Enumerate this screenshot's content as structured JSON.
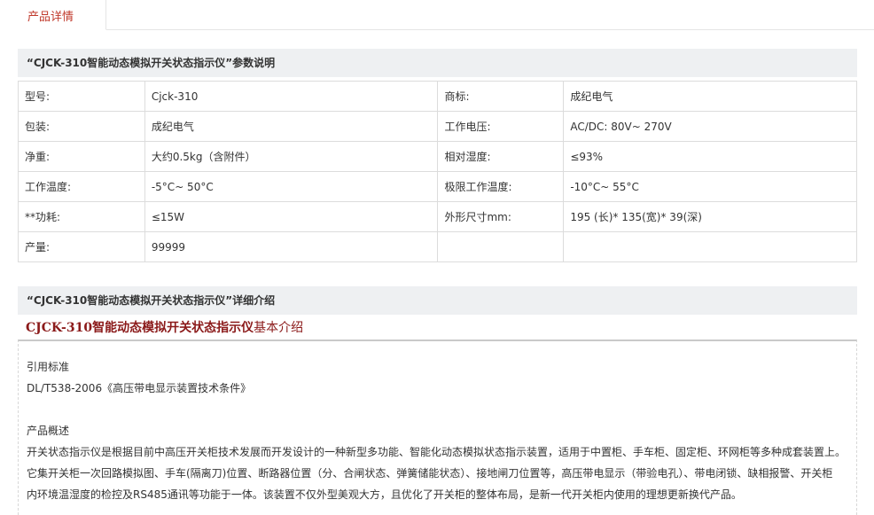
{
  "tabs": [
    {
      "label": "产品详情"
    }
  ],
  "params_section": {
    "title": "“CJCK-310智能动态模拟开关状态指示仪”参数说明"
  },
  "params": [
    [
      "型号:",
      "Cjck-310",
      "商标:",
      "成纪电气"
    ],
    [
      "包装:",
      "成纪电气",
      "工作电压:",
      "AC/DC:  80V~ 270V"
    ],
    [
      "净重:",
      "大约0.5kg（含附件）",
      "相对湿度:",
      "≤93%"
    ],
    [
      "工作温度:",
      "-5°C~ 50°C",
      "极限工作温度:",
      "-10°C~ 55°C"
    ],
    [
      "**功耗:",
      "≤15W",
      "外形尺寸mm:",
      "195 (长)* 135(宽)* 39(深)"
    ],
    [
      "产量:",
      "99999",
      "",
      ""
    ]
  ],
  "detail_section": {
    "title": "“CJCK-310智能动态模拟开关状态指示仪”详细介绍",
    "subheading_bold": "CJCK-310智能动态模拟开关状态指示仪",
    "subheading_rest": "基本介绍"
  },
  "intro": {
    "standard_label": "引用标准",
    "standard_text": "DL/T538-2006《高压带电显示装置技术条件》",
    "overview_label": "产品概述",
    "overview_lines": [
      "开关状态指示仪是根据目前中高压开关柜技术发展而开发设计的一种新型多功能、智能化动态模拟状态指示装置，适用于中置柜、手车柜、固定柜、环网柜等多种成套装置上。",
      "它集开关柜一次回路模拟图、手车(隔离刀)位置、断路器位置（分、合闸状态、弹簧储能状态）、接地闸刀位置等，高压带电显示（带验电孔）、带电闭锁、缺相报警、开关柜",
      "内环境温湿度的检控及RS485通讯等功能于一体。该装置不仅外型美观大方，且优化了开关柜的整体布局，是新一代开关柜内使用的理想更新换代产品。"
    ]
  }
}
